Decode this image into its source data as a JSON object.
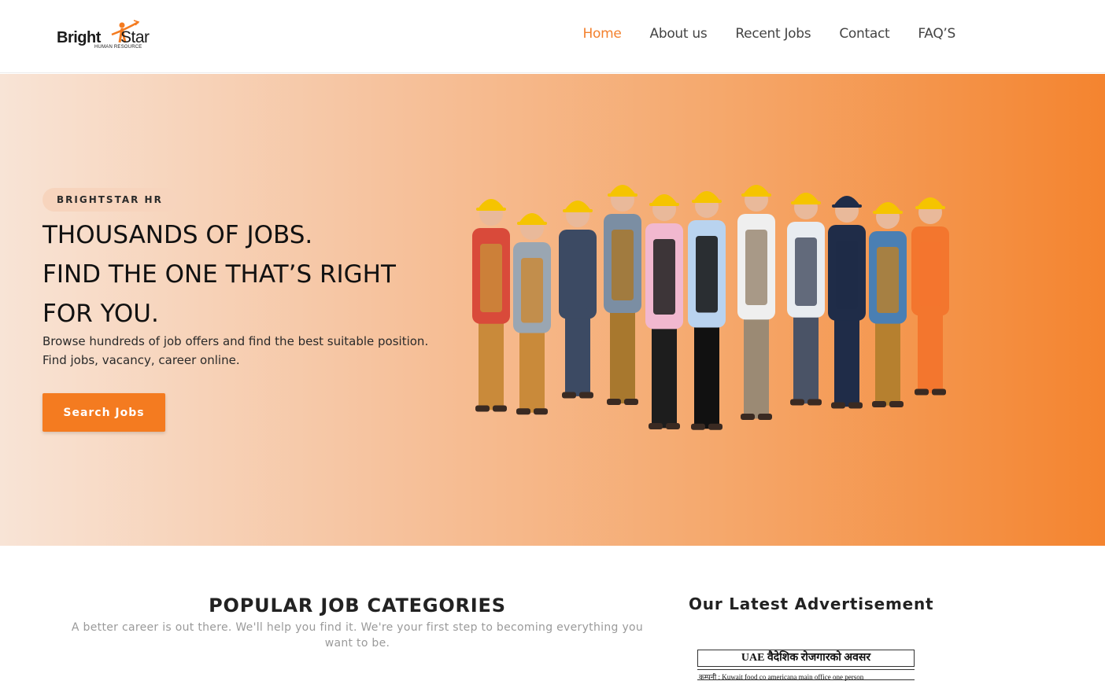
{
  "header": {
    "logo": {
      "bright": "Bright",
      "star": "Star",
      "sub": "HUMAN RESOURCE"
    },
    "nav": [
      {
        "label": "Home",
        "active": true
      },
      {
        "label": "About us",
        "active": false
      },
      {
        "label": "Recent Jobs",
        "active": false
      },
      {
        "label": "Contact",
        "active": false
      },
      {
        "label": "FAQ’S",
        "active": false
      }
    ]
  },
  "hero": {
    "badge": "BRIGHTSTAR HR",
    "title_lines": [
      "THOUSANDS OF JOBS.",
      "FIND THE ONE THAT’S RIGHT",
      "FOR YOU."
    ],
    "desc_lines": [
      "Browse hundreds of job offers and find the best suitable position.",
      "Find jobs, vacancy, career online."
    ],
    "button": "Search Jobs",
    "image_icon": "workers-group-illustration"
  },
  "categories": {
    "title": "POPULAR JOB CATEGORIES",
    "subtitle": "A better career is out there. We'll help you find it. We're your first step to becoming everything you want to be."
  },
  "advertisement": {
    "title": "Our Latest Advertisement",
    "doc_heading": "UAE वैदेशिक रोजगारको अवसर",
    "doc_line": "कम्पनी : Kuwait food co americana main office one person"
  },
  "colors": {
    "accent": "#f47b20",
    "nav_active": "#f3812e",
    "hero_start": "#f8e4d6",
    "hero_end": "#f4842f"
  }
}
